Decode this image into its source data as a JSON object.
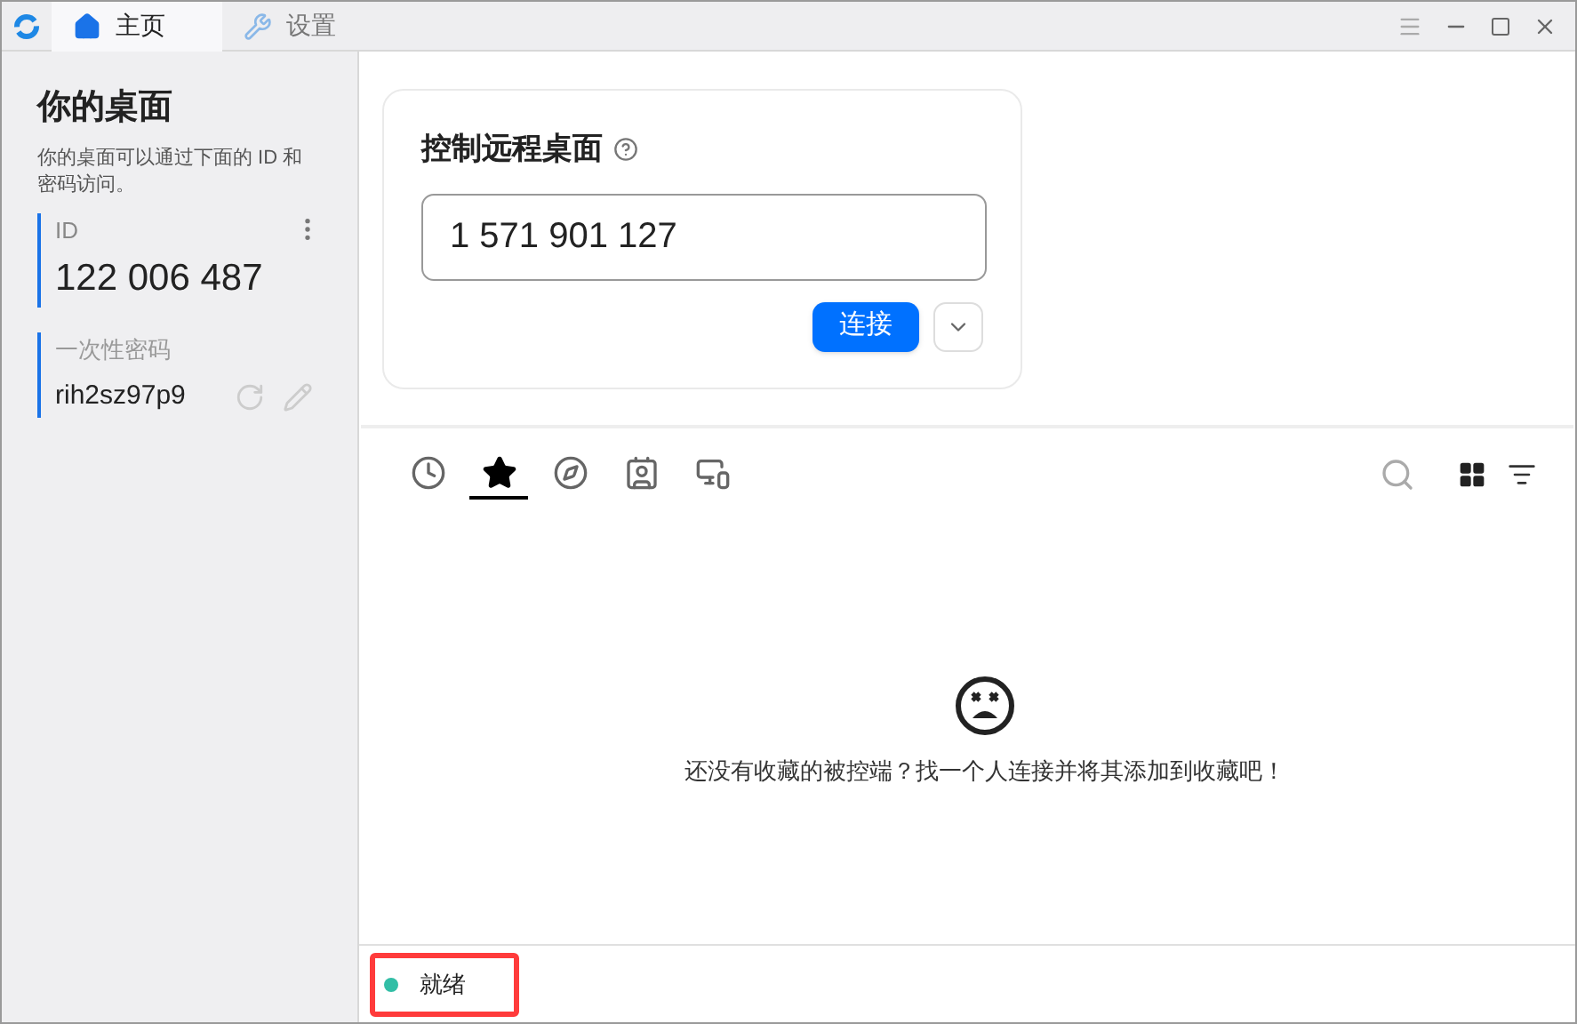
{
  "window_tabs": [
    {
      "label": "主页",
      "kind": "home",
      "selected": true
    },
    {
      "label": "设置",
      "kind": "settings",
      "selected": false
    }
  ],
  "sidebar": {
    "title": "你的桌面",
    "description": "你的桌面可以通过下面的 ID 和密码访问。",
    "id_label": "ID",
    "id_value": "122 006 487",
    "password_label": "一次性密码",
    "password_value": "rih2sz97p9"
  },
  "remote": {
    "title": "控制远程桌面",
    "id_input": "1 571 901 127",
    "connect_button": "连接"
  },
  "peer_tabs": [
    {
      "kind": "recent",
      "selected": false
    },
    {
      "kind": "favorites",
      "selected": true
    },
    {
      "kind": "discovered",
      "selected": false
    },
    {
      "kind": "address_book",
      "selected": false
    },
    {
      "kind": "group",
      "selected": false
    }
  ],
  "empty_message": "还没有收藏的被控端？找一个人连接并将其添加到收藏吧！",
  "status_bar": {
    "text": "就绪",
    "color": "#32bea6"
  }
}
